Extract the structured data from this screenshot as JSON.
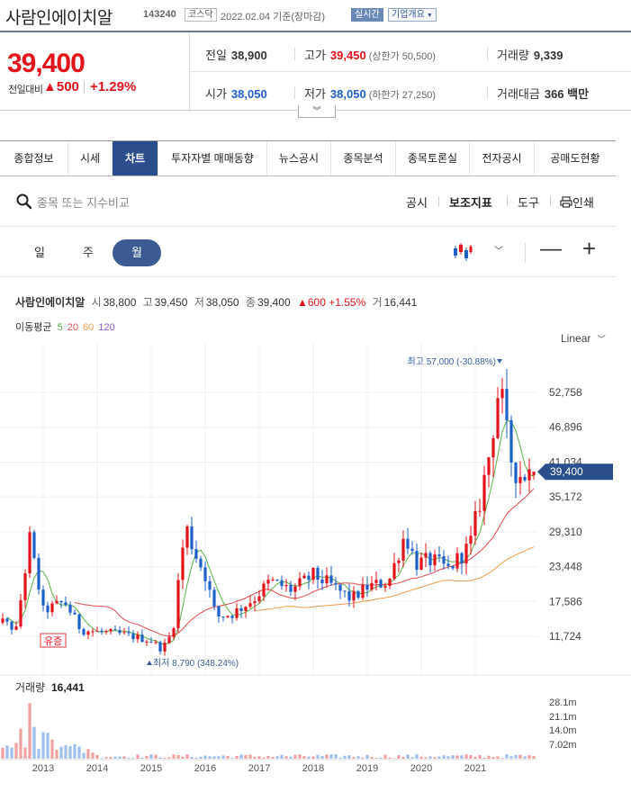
{
  "header": {
    "stock_name": "사람인에이치알",
    "stock_code": "143240",
    "market": "코스닥",
    "date": "2022.02.04 기준(장마감)",
    "realtime": "실시간",
    "overview": "기업개요"
  },
  "price": {
    "current": "39,400",
    "diff_label": "전일대비",
    "diff_value": "▲500",
    "diff_pct": "+1.29%",
    "prev_label": "전일",
    "prev_value": "38,900",
    "high_label": "고가",
    "high_value": "39,450",
    "upper_limit": "(상한가 50,500)",
    "volume_label": "거래량",
    "volume_value": "9,339",
    "open_label": "시가",
    "open_value": "38,050",
    "low_label": "저가",
    "low_value": "38,050",
    "lower_limit": "(하한가 27,250)",
    "amount_label": "거래대금",
    "amount_value": "366 백만"
  },
  "tabs": [
    "종합정보",
    "시세",
    "차트",
    "투자자별 매매동향",
    "뉴스공시",
    "종목분석",
    "종목토론실",
    "전자공시",
    "공매도현황"
  ],
  "active_tab": "차트",
  "toolbar": {
    "search_placeholder": "종목 또는 지수비교",
    "disclosure": "공시",
    "indicators": "보조지표",
    "tools": "도구",
    "print": "인쇄"
  },
  "periods": [
    "일",
    "주",
    "월"
  ],
  "active_period": "월",
  "info": {
    "name": "사람인에이치알",
    "open_k": "시",
    "open_v": "38,800",
    "high_k": "고",
    "high_v": "39,450",
    "low_k": "저",
    "low_v": "38,050",
    "close_k": "종",
    "close_v": "39,400",
    "change": "▲600 +1.55%",
    "vol_k": "거",
    "vol_v": "16,441"
  },
  "ma": {
    "label": "이동평균",
    "p5": "5",
    "p20": "20",
    "p60": "60",
    "p120": "120"
  },
  "scale_mode": "Linear",
  "colors": {
    "up": "#e2131a",
    "down": "#1e5fc8",
    "ma5": "#58b345",
    "ma20": "#e14b4b",
    "ma60": "#f09a4a",
    "ma120": "#8a58c8",
    "accent": "#2b4e8c"
  },
  "chart_data": {
    "type": "candlestick",
    "interval": "monthly",
    "x_ticks": [
      "2013",
      "2014",
      "2015",
      "2016",
      "2017",
      "2018",
      "2019",
      "2020",
      "2021"
    ],
    "y_ticks": [
      "52,758",
      "46,896",
      "41,034",
      "35,172",
      "29,310",
      "23,448",
      "17,586",
      "11,724"
    ],
    "ylim": [
      7500,
      60000
    ],
    "last_price_label": "39,400",
    "high_annotation": "최고 57,000 (-30.88%)",
    "low_annotation": "최저 8,790 (348.24%)",
    "event_label": "유증",
    "volume": {
      "label": "거래량",
      "value": "16,441",
      "y_ticks": [
        "28.1m",
        "21.1m",
        "14.0m",
        "7.02m"
      ]
    },
    "close_path": [
      [
        2012.0,
        15500
      ],
      [
        2012.5,
        12800
      ],
      [
        2012.75,
        28000
      ],
      [
        2013.0,
        16000
      ],
      [
        2013.4,
        17500
      ],
      [
        2013.7,
        12800
      ],
      [
        2014.0,
        12500
      ],
      [
        2014.5,
        12000
      ],
      [
        2015.0,
        11000
      ],
      [
        2015.2,
        9500
      ],
      [
        2015.4,
        12500
      ],
      [
        2015.55,
        25000
      ],
      [
        2015.65,
        30000
      ],
      [
        2015.8,
        26000
      ],
      [
        2016.0,
        22000
      ],
      [
        2016.2,
        15000
      ],
      [
        2016.5,
        15500
      ],
      [
        2016.9,
        18000
      ],
      [
        2017.2,
        21000
      ],
      [
        2017.6,
        19500
      ],
      [
        2018.0,
        22000
      ],
      [
        2018.3,
        20500
      ],
      [
        2018.7,
        18000
      ],
      [
        2019.0,
        20000
      ],
      [
        2019.4,
        21000
      ],
      [
        2019.7,
        29000
      ],
      [
        2019.9,
        24000
      ],
      [
        2020.2,
        24500
      ],
      [
        2020.5,
        23000
      ],
      [
        2020.7,
        25000
      ],
      [
        2020.9,
        27000
      ],
      [
        2021.1,
        35000
      ],
      [
        2021.25,
        42000
      ],
      [
        2021.45,
        54500
      ],
      [
        2021.55,
        47000
      ],
      [
        2021.7,
        40000
      ],
      [
        2021.85,
        38800
      ],
      [
        2022.0,
        39400
      ]
    ]
  }
}
